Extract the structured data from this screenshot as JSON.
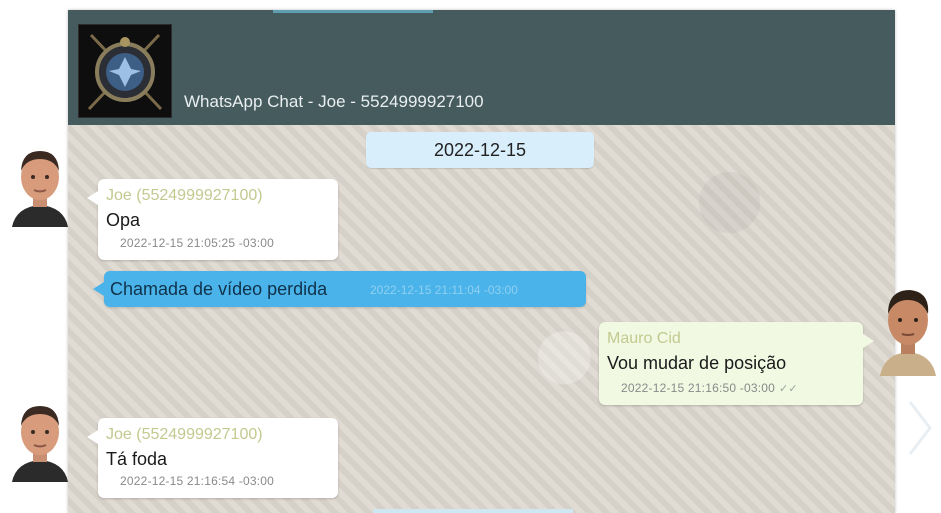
{
  "header": {
    "title": "WhatsApp Chat - Joe - 5524999927100",
    "avatar_icon": "shield-emblem-icon"
  },
  "date_separator": "2022-12-15",
  "messages": [
    {
      "direction": "incoming",
      "sender": "Joe (5524999927100)",
      "text": "Opa",
      "timestamp": "2022-12-15 21:05:25 -03:00"
    },
    {
      "direction": "system",
      "text": "Chamada de vídeo perdida",
      "timestamp": "2022-12-15 21:11:04 -03:00"
    },
    {
      "direction": "outgoing",
      "sender": "Mauro Cid",
      "text": "Vou mudar de posição",
      "timestamp": "2022-12-15 21:16:50 -03:00",
      "status": "read"
    },
    {
      "direction": "incoming",
      "sender": "Joe (5524999927100)",
      "text": "Tá foda",
      "timestamp": "2022-12-15 21:16:54 -03:00"
    }
  ],
  "colors": {
    "header": "#465b5e",
    "incoming_bubble": "#ffffff",
    "outgoing_bubble": "#f1f9e3",
    "call_bubble": "#4ab3ea",
    "date_pill": "#d8eefa",
    "sender_name": "#c3c98f"
  }
}
